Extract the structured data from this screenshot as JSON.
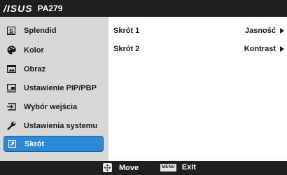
{
  "header": {
    "brand": "/ISUS",
    "model": "PA279"
  },
  "sidebar": {
    "items": [
      {
        "label": "Splendid",
        "icon": "splendid-s-icon",
        "selected": false
      },
      {
        "label": "Kolor",
        "icon": "palette-icon",
        "selected": false
      },
      {
        "label": "Obraz",
        "icon": "image-icon",
        "selected": false
      },
      {
        "label": "Ustawienie PIP/PBP",
        "icon": "pip-icon",
        "selected": false
      },
      {
        "label": "Wybór wejścia",
        "icon": "input-icon",
        "selected": false
      },
      {
        "label": "Ustawienia systemu",
        "icon": "wrench-icon",
        "selected": false
      },
      {
        "label": "Skrót",
        "icon": "shortcut-icon",
        "selected": true
      }
    ]
  },
  "content": {
    "rows": [
      {
        "label": "Skrót 1",
        "value": "Jasność"
      },
      {
        "label": "Skrót 2",
        "value": "Kontrast"
      }
    ]
  },
  "footer": {
    "move_label": "Move",
    "menu_key": "MENU",
    "exit_label": "Exit"
  },
  "colors": {
    "selected": "#2b8ad8",
    "bar": "#1f1f1f",
    "sidebar": "#d7d7d7"
  }
}
